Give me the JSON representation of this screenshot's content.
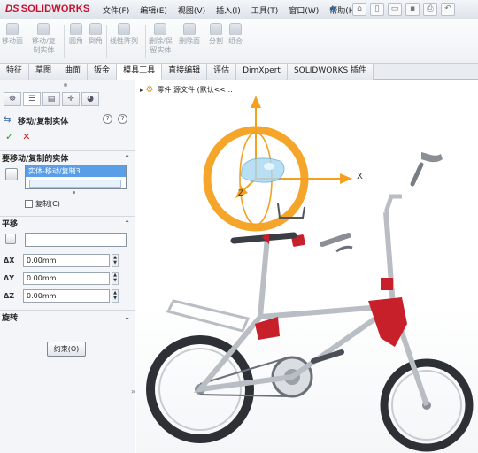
{
  "app": {
    "logo_ds": "DS",
    "logo_name": "SOLIDWORKS"
  },
  "menu": [
    "文件(F)",
    "编辑(E)",
    "视图(V)",
    "插入(I)",
    "工具(T)",
    "窗口(W)",
    "帮助(H)"
  ],
  "ribbon": {
    "buttons": [
      {
        "label1": "移动面",
        "label2": ""
      },
      {
        "label1": "移动/复",
        "label2": "制实体"
      },
      {
        "label1": "圆角",
        "label2": ""
      },
      {
        "label1": "倒角",
        "label2": ""
      },
      {
        "label1": "线性阵列",
        "label2": ""
      },
      {
        "label1": "删除/保",
        "label2": "留实体"
      },
      {
        "label1": "删除面",
        "label2": ""
      },
      {
        "label1": "分割",
        "label2": ""
      },
      {
        "label1": "组合",
        "label2": ""
      }
    ]
  },
  "tabs": [
    "特征",
    "草图",
    "曲面",
    "钣金",
    "模具工具",
    "直接编辑",
    "评估",
    "DimXpert",
    "SOLIDWORKS 插件"
  ],
  "active_tab": "模具工具",
  "panel": {
    "title": "移动/复制实体",
    "help1": "?",
    "help2": "?",
    "ok_symbol": "✓",
    "cancel_symbol": "✕",
    "bodies_group": "要移动/复制的实体",
    "selected_body": "实体-移动/复制3",
    "copy_label": "复制(C)",
    "translate_group": "平移",
    "fields": [
      {
        "axis": "ΔX",
        "value": "0.00mm"
      },
      {
        "axis": "ΔY",
        "value": "0.00mm"
      },
      {
        "axis": "ΔZ",
        "value": "0.00mm"
      }
    ],
    "rotate_group": "旋转",
    "constraints_button": "约束(O)"
  },
  "viewport": {
    "tree_text": "零件 源文件  (默认<<...",
    "axis_x": "X",
    "axis_z": "Z"
  },
  "colors": {
    "accent": "#f5a020",
    "bike_red": "#c8202a",
    "selection_blue": "#5a9ee8",
    "frame_metal": "#b9bec4"
  }
}
